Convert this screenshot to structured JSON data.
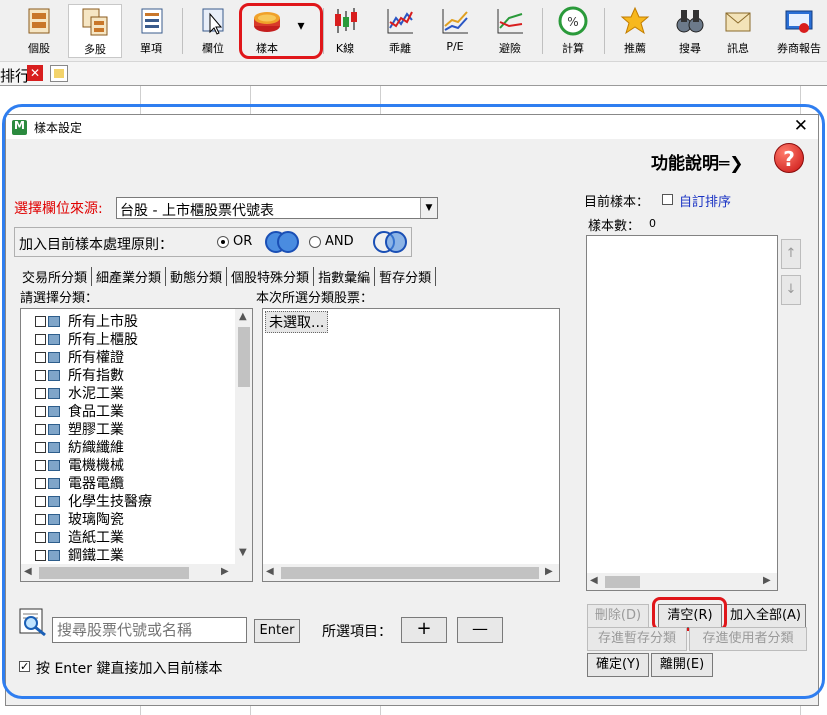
{
  "toolbar": {
    "items": [
      {
        "label": "個股",
        "icon": "single-stock-icon"
      },
      {
        "label": "多股",
        "icon": "multi-stock-icon"
      },
      {
        "label": "單項",
        "icon": "single-item-icon"
      },
      {
        "label": "欄位",
        "icon": "column-cursor-icon"
      },
      {
        "label": "樣本",
        "icon": "sample-database-icon"
      },
      {
        "label": "K線",
        "icon": "candlestick-icon"
      },
      {
        "label": "乖離",
        "icon": "deviation-icon"
      },
      {
        "label": "P/E",
        "icon": "pe-chart-icon"
      },
      {
        "label": "避險",
        "icon": "hedge-chart-icon"
      },
      {
        "label": "計算",
        "icon": "percent-calc-icon"
      },
      {
        "label": "推薦",
        "icon": "star-icon"
      },
      {
        "label": "搜尋",
        "icon": "binoculars-icon"
      },
      {
        "label": "訊息",
        "icon": "mail-icon"
      },
      {
        "label": "券商報告",
        "icon": "broker-report-icon"
      }
    ],
    "dropdown_symbol": "▾"
  },
  "tabstrip": {
    "partial_tab_text": "排行",
    "close_symbol": "✕"
  },
  "dialog": {
    "title": "樣本設定",
    "close_symbol": "✕",
    "help_text": "功能說明═❯",
    "help_symbol": "?",
    "source_label": "選擇欄位來源:",
    "source_value": "台股 - 上市櫃股票代號表",
    "select_arrow": "▼",
    "rule_label": "加入目前樣本處理原則：",
    "or_label": "OR",
    "and_label": "AND",
    "tabs": [
      "交易所分類",
      "細產業分類",
      "動態分類",
      "個股特殊分類",
      "指數彙編",
      "暫存分類"
    ],
    "category_label": "請選擇分類：",
    "categories": [
      "所有上市股",
      "所有上櫃股",
      "所有權證",
      "所有指數",
      "水泥工業",
      "食品工業",
      "塑膠工業",
      "紡織纖維",
      "電機機械",
      "電器電纜",
      "化學生技醫療",
      "玻璃陶瓷",
      "造紙工業",
      "鋼鐵工業"
    ],
    "selected_stocks_label": "本次所選分類股票：",
    "selected_stocks_placeholder": "未選取...",
    "current_sample_label": "目前樣本：",
    "custom_sort_label": "自訂排序",
    "sample_count_label": "樣本數：",
    "sample_count": "0",
    "up_symbol": "↑",
    "down_symbol": "↓",
    "search_placeholder": "搜尋股票代號或名稱",
    "enter_button": "Enter",
    "selected_items_label": "所選項目：",
    "plus_button": "+",
    "minus_button": "—",
    "enter_checkbox_label": "按 Enter 鍵直接加入目前樣本",
    "buttons": {
      "delete": "刪除(D)",
      "clear": "清空(R)",
      "add_all": "加入全部(A)",
      "save_temp": "存進暫存分類",
      "save_user": "存進使用者分類",
      "ok": "確定(Y)",
      "leave": "離開(E)"
    }
  },
  "colors": {
    "highlight_red": "#e0161a",
    "outline_blue": "#2f7ef0",
    "source_label_red": "#e00000",
    "link_blue": "#1a33c4"
  }
}
